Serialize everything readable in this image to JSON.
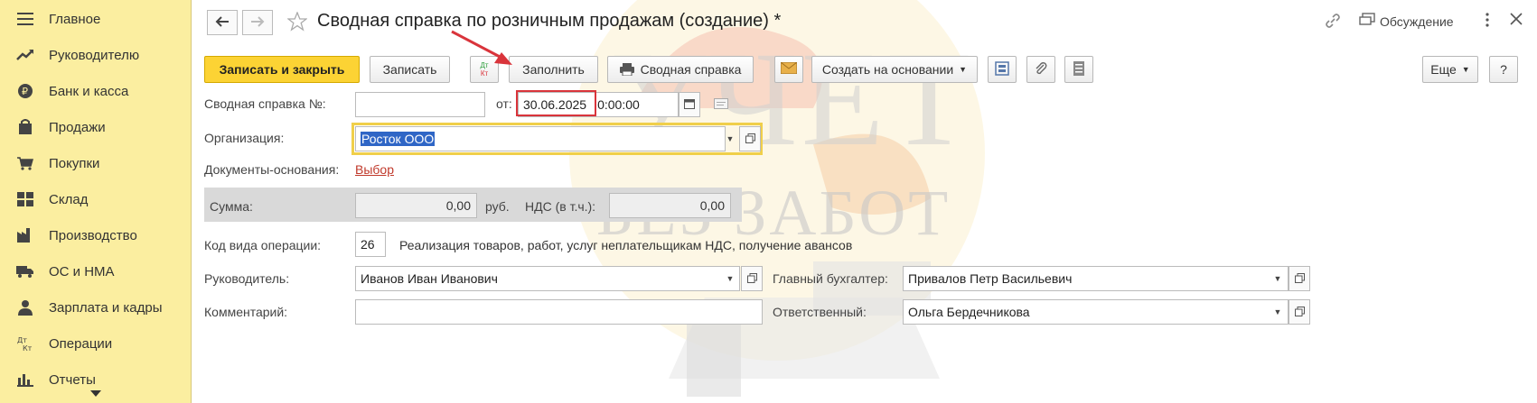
{
  "sidebar": {
    "items": [
      {
        "label": "Главное",
        "icon": "menu-icon"
      },
      {
        "label": "Руководителю",
        "icon": "trend-icon"
      },
      {
        "label": "Банк и касса",
        "icon": "ruble-coin-icon"
      },
      {
        "label": "Продажи",
        "icon": "shopping-bag-icon"
      },
      {
        "label": "Покупки",
        "icon": "cart-icon"
      },
      {
        "label": "Склад",
        "icon": "warehouse-icon"
      },
      {
        "label": "Производство",
        "icon": "factory-icon"
      },
      {
        "label": "ОС и НМА",
        "icon": "truck-icon"
      },
      {
        "label": "Зарплата и кадры",
        "icon": "person-icon"
      },
      {
        "label": "Операции",
        "icon": "dt-kt-icon"
      },
      {
        "label": "Отчеты",
        "icon": "bar-chart-icon"
      }
    ]
  },
  "watermark": {
    "line1": "УЧЕТ",
    "line2": "БЕЗ ЗАБОТ"
  },
  "header": {
    "title": "Сводная справка по розничным продажам (создание) *",
    "discussion": "Обсуждение"
  },
  "toolbar": {
    "save_close": "Записать и закрыть",
    "save": "Записать",
    "fill": "Заполнить",
    "print_summary": "Сводная справка",
    "create_based": "Создать на основании",
    "more": "Еще",
    "help": "?",
    "dtkt_top": "Дт",
    "dtkt_bottom": "Кт"
  },
  "form": {
    "doc_number_label": "Сводная справка №:",
    "doc_number_value": "",
    "from_label": "от:",
    "date_value": "30.06.2025",
    "time_value": "0:00:00",
    "org_label": "Организация:",
    "org_value": "Росток ООО",
    "base_docs_label": "Документы-основания:",
    "base_docs_link": "Выбор",
    "sum_label": "Сумма:",
    "sum_value": "0,00",
    "currency": "руб.",
    "vat_label": "НДС (в т.ч.):",
    "vat_value": "0,00",
    "op_code_label": "Код вида операции:",
    "op_code_value": "26",
    "op_code_desc": "Реализация товаров, работ, услуг неплательщикам НДС, получение авансов",
    "manager_label": "Руководитель:",
    "manager_value": "Иванов Иван Иванович",
    "chief_acc_label": "Главный бухгалтер:",
    "chief_acc_value": "Привалов Петр Васильевич",
    "comment_label": "Комментарий:",
    "comment_value": "",
    "responsible_label": "Ответственный:",
    "responsible_value": "Ольга Бердечникова"
  },
  "colors": {
    "sidebar_bg": "#fbeea0",
    "primary_button": "#fcd334",
    "highlight_red": "#d9343b",
    "selection": "#2f66c6"
  }
}
